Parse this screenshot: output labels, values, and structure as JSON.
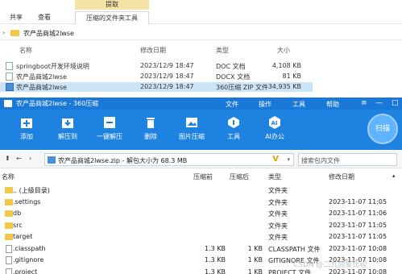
{
  "explorer": {
    "extract_label": "提取",
    "tabs": [
      "共享",
      "查看",
      "压缩的文件夹工具"
    ],
    "address": "农产品商城2lwse",
    "columns": {
      "name": "名称",
      "date": "修改日期",
      "type": "类型",
      "size": "大小"
    },
    "files": [
      {
        "name": "springboot开发环境说明",
        "date": "2023/12/9 18:47",
        "type": "DOC 文档",
        "size": "4,108 KB"
      },
      {
        "name": "农产品商城2lwse",
        "date": "2023/12/9 18:47",
        "type": "DOCX 文档",
        "size": "81 KB"
      },
      {
        "name": "农产品商城2lwse",
        "date": "2023/12/9 18:47",
        "type": "360压缩 ZIP 文件",
        "size": "34,935 KB"
      }
    ]
  },
  "zip": {
    "title": "农产品商城2lwse - 360压缩",
    "menu": [
      "文件",
      "操作",
      "工具",
      "帮助"
    ],
    "toolbar": [
      "添加",
      "解压到",
      "一键解压",
      "删除",
      "图片压缩",
      "工具",
      "AI办公"
    ],
    "scan_label": "扫描",
    "path": "农产品商城2lwse.zip - 解包大小为 68.3 MB",
    "search_placeholder": "搜索包内文件",
    "columns": {
      "name": "名称",
      "packed": "压缩前",
      "size": "压缩后",
      "type": "类型",
      "date": "修改日期"
    },
    "rows": [
      {
        "name": ".. (上级目录)",
        "packed": "",
        "size": "",
        "type": "文件夹",
        "date": "",
        "kind": "dir"
      },
      {
        "name": ".settings",
        "packed": "",
        "size": "",
        "type": "文件夹",
        "date": "2023-11-07 11:05",
        "kind": "dir"
      },
      {
        "name": "db",
        "packed": "",
        "size": "",
        "type": "文件夹",
        "date": "2023-11-07 11:06",
        "kind": "dir"
      },
      {
        "name": "src",
        "packed": "",
        "size": "",
        "type": "文件夹",
        "date": "2023-11-07 11:05",
        "kind": "dir"
      },
      {
        "name": "target",
        "packed": "",
        "size": "",
        "type": "文件夹",
        "date": "2023-11-07 11:05",
        "kind": "dir"
      },
      {
        "name": ".classpath",
        "packed": "1.3 KB",
        "size": "1 KB",
        "type": "CLASSPATH 文件",
        "date": "2023-11-07 10:08",
        "kind": "file"
      },
      {
        "name": ".gitignore",
        "packed": "1.3 KB",
        "size": "1 KB",
        "type": "GITIGNORE 文件",
        "date": "2023-11-07 10:08",
        "kind": "file"
      },
      {
        "name": ".project",
        "packed": "1.3 KB",
        "size": "1 KB",
        "type": "PROJECT 文件",
        "date": "2023-11-07 10:08",
        "kind": "file"
      }
    ]
  },
  "watermark": "CSDN @二九筒爱比较"
}
